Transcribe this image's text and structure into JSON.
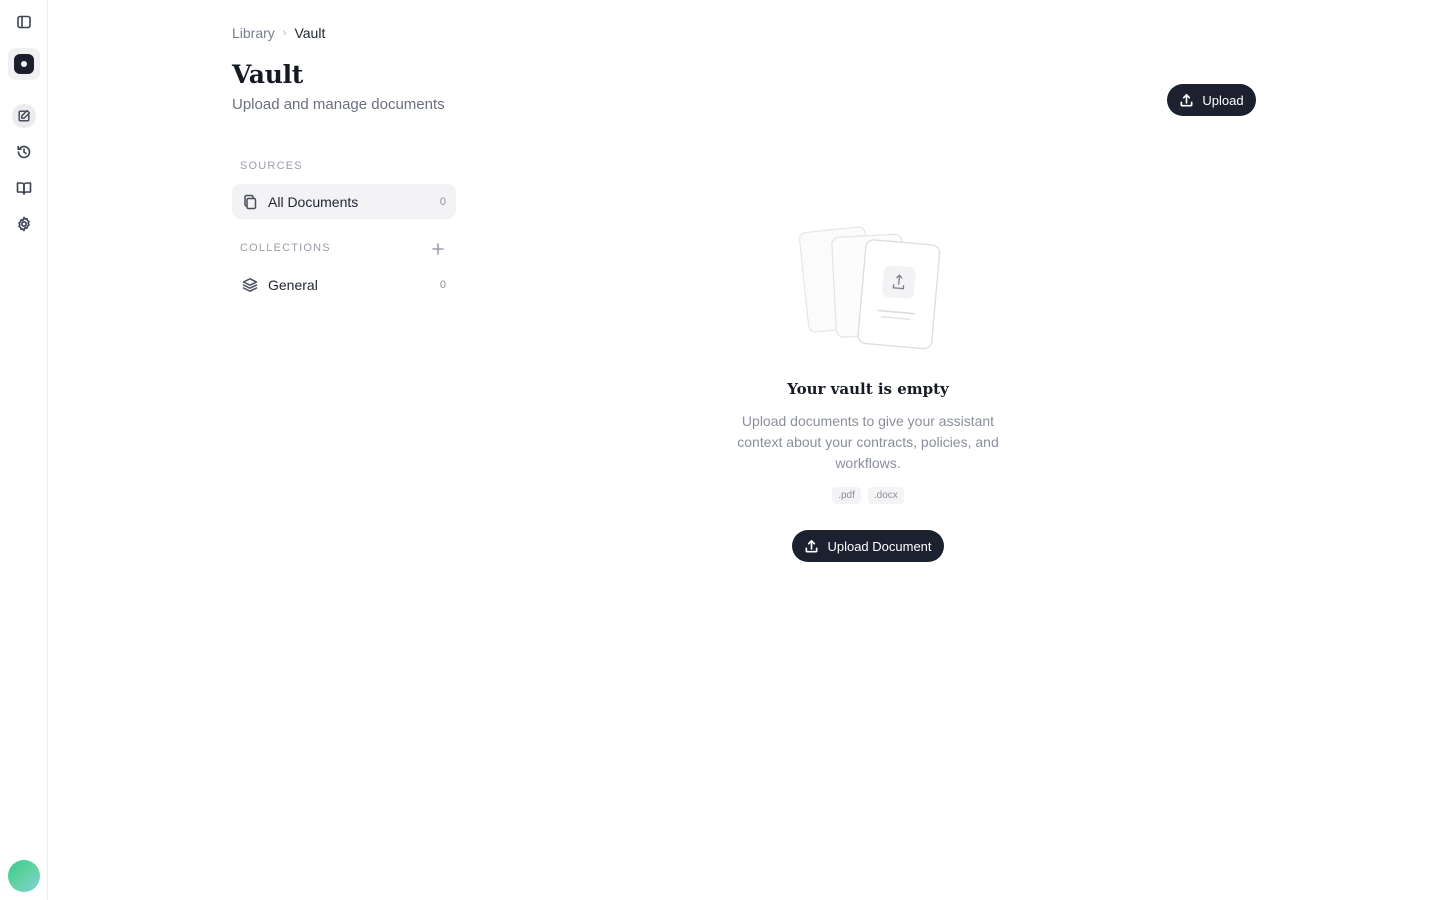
{
  "icons": {
    "sidebar_toggle": "sidebar-toggle-icon",
    "logo": "logo-icon",
    "new_chat": "edit-icon",
    "history": "history-icon",
    "library": "book-icon",
    "settings": "gear-icon",
    "upload": "upload-icon",
    "documents": "documents-icon",
    "layers": "layers-icon",
    "plus": "plus-icon"
  },
  "colors": {
    "primary_button": "#1c2130",
    "active_nav_bg": "#f3f3f5",
    "avatar_gradient_start": "#38c98a",
    "avatar_gradient_end": "#7ecde0"
  },
  "breadcrumb": {
    "parent": "Library",
    "current": "Vault"
  },
  "header": {
    "title": "Vault",
    "subtitle": "Upload and manage documents",
    "upload_label": "Upload"
  },
  "sources": {
    "label": "SOURCES",
    "items": [
      {
        "label": "All Documents",
        "count": "0"
      }
    ]
  },
  "collections": {
    "label": "COLLECTIONS",
    "items": [
      {
        "label": "General",
        "count": "0"
      }
    ]
  },
  "empty_state": {
    "title": "Your vault is empty",
    "description": "Upload documents to give your assistant context about your contracts, policies, and workflows.",
    "file_types": [
      ".pdf",
      ".docx"
    ],
    "button_label": "Upload Document"
  }
}
